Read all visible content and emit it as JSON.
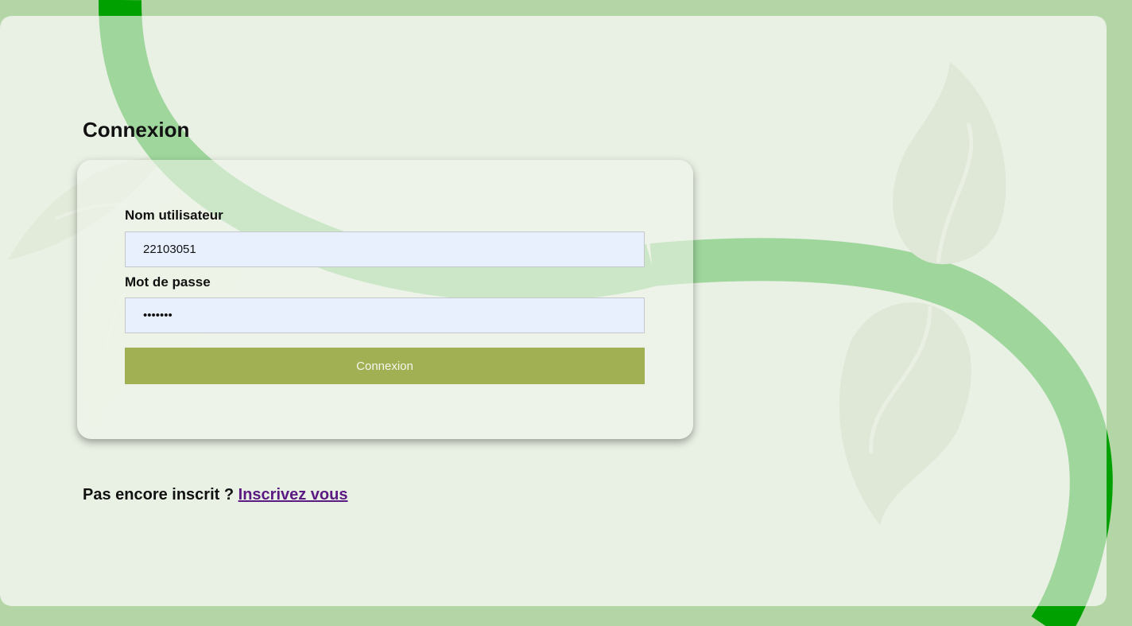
{
  "login": {
    "title": "Connexion",
    "username_label": "Nom utilisateur",
    "username_value": "22103051",
    "password_label": "Mot de passe",
    "password_value": "1234567",
    "submit_label": "Connexion"
  },
  "signup": {
    "prompt": "Pas encore inscrit ?",
    "link_label": "Inscrivez vous"
  },
  "colors": {
    "page_background": "#b4d6a6",
    "panel_background": "#e9f0e4",
    "button": "#a1b052",
    "input_background": "#e8f0fe",
    "link": "#5a1a82",
    "vine": "#00a000"
  }
}
